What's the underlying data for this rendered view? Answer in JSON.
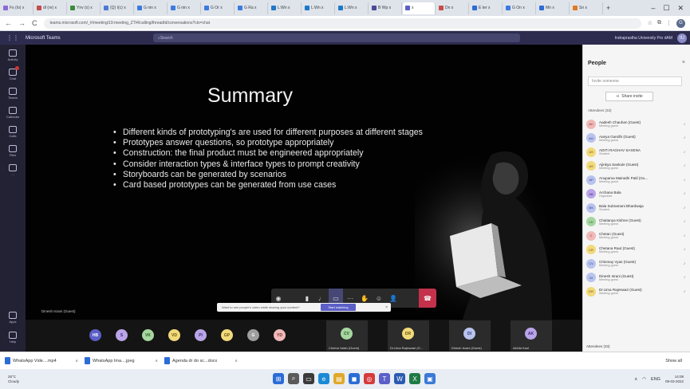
{
  "colors": {
    "teams_header": "#2d2c4f",
    "teams_accent": "#5b5fc7",
    "hangup": "#c4314b",
    "stage_bg": "#050505",
    "panel_bg": "#f5f5f5"
  },
  "browser": {
    "tabs": [
      {
        "label": "Fs (Io) x",
        "color": "#8a6ad6",
        "active": false
      },
      {
        "label": "dl (re) x",
        "color": "#c44c4c",
        "active": false
      },
      {
        "label": "Ynv (x) x",
        "color": "#3b8b3b",
        "active": false
      },
      {
        "label": "(Q) I(c) x",
        "color": "#4a7ad6",
        "active": false
      },
      {
        "label": "G nin x",
        "color": "#3b7be0",
        "active": false
      },
      {
        "label": "G nin x",
        "color": "#3b7be0",
        "active": false
      },
      {
        "label": "G Or x",
        "color": "#3b7be0",
        "active": false
      },
      {
        "label": "G Ra x",
        "color": "#3b7be0",
        "active": false
      },
      {
        "label": "L:Wn x",
        "color": "#1f78c8",
        "active": false
      },
      {
        "label": "L:Wn x",
        "color": "#1f78c8",
        "active": false
      },
      {
        "label": "L:Wn x",
        "color": "#1f78c8",
        "active": false
      },
      {
        "label": "B Wp x",
        "color": "#4a4a9a",
        "active": false
      },
      {
        "label": "x",
        "color": "#5b5fc7",
        "active": true
      },
      {
        "label": "Dn x",
        "color": "#c44c4c",
        "active": false
      },
      {
        "label": "E ter x",
        "color": "#2b6cd6",
        "active": false
      },
      {
        "label": "G On x",
        "color": "#3b7be0",
        "active": false
      },
      {
        "label": "Mn x",
        "color": "#2b6cd6",
        "active": false
      },
      {
        "label": "Sn x",
        "color": "#e07a1f",
        "active": false
      }
    ],
    "new_tab": "+",
    "window_controls": [
      "–",
      "☐",
      "✕"
    ],
    "url": "teams.microsoft.com/_#/meeting/19:meeting_ZTI4/calling/threadId/conversations?ctx=chat"
  },
  "teams": {
    "waffle_icon": "grid-icon",
    "app_name": "Microsoft Teams",
    "search_placeholder": "Search",
    "org_name": "Indraprastha University Pro dAM",
    "user_initials": "IU"
  },
  "rail": {
    "items": [
      {
        "name": "activity",
        "label": "Activity",
        "badge": false
      },
      {
        "name": "chat",
        "label": "Chat",
        "badge": true
      },
      {
        "name": "teams",
        "label": "Teams",
        "badge": false
      },
      {
        "name": "calendar",
        "label": "Calendar",
        "badge": false
      },
      {
        "name": "calls",
        "label": "Calls",
        "badge": false
      },
      {
        "name": "files",
        "label": "Files",
        "badge": false
      },
      {
        "name": "more",
        "label": "...",
        "badge": false
      }
    ],
    "bottom": [
      {
        "name": "apps",
        "label": "Apps"
      },
      {
        "name": "help",
        "label": "Help"
      }
    ]
  },
  "slide": {
    "title": "Summary",
    "bullets": [
      "Different kinds of prototyping's are used for different purposes at different stages",
      "Prototypes answer questions, so prototype appropriately",
      "Construction: the final product must be engineered appropriately",
      "Consider interaction types & interface types to prompt creativity",
      "Storyboards can be generated by scenarios",
      "Card based prototypes can be generated from use cases"
    ],
    "presenter_label": "Dinesh Israni (Guest)"
  },
  "controls": {
    "buttons": [
      {
        "name": "timer",
        "glyph": "◉"
      },
      {
        "name": "blank",
        "glyph": " "
      },
      {
        "name": "camera",
        "glyph": "▮"
      },
      {
        "name": "mic",
        "glyph": "♩"
      },
      {
        "name": "share",
        "glyph": "▭"
      },
      {
        "name": "more",
        "glyph": "···"
      },
      {
        "name": "raise-hand",
        "glyph": "✋"
      },
      {
        "name": "reactions",
        "glyph": "☺"
      },
      {
        "name": "people",
        "glyph": "👤"
      }
    ],
    "hangup_glyph": "☎"
  },
  "banner": {
    "text": "Want to see people's video while sharing your content?",
    "button": "Start watching",
    "close": "×"
  },
  "participants_strip": [
    {
      "initials": "HB",
      "bg": "#5b5fc7",
      "fg": "#fff"
    },
    {
      "initials": "S",
      "bg": "#b9a4e8",
      "fg": "#3b2a7a"
    },
    {
      "initials": "VK",
      "bg": "#a6d7a0",
      "fg": "#2c5a25"
    },
    {
      "initials": "VD",
      "bg": "#f2d97a",
      "fg": "#6b5510"
    },
    {
      "initials": "PI",
      "bg": "#b9a4e8",
      "fg": "#3b2a7a"
    },
    {
      "initials": "GP",
      "bg": "#f2d97a",
      "fg": "#6b5510"
    },
    {
      "initials": "G",
      "bg": "#9e9e9e",
      "fg": "#fff"
    },
    {
      "initials": "YD",
      "bg": "#f0b9b9",
      "fg": "#7a2a2a"
    }
  ],
  "speaker_tiles": [
    {
      "initials": "CV",
      "bg": "#a6d7a0",
      "fg": "#2c5a25",
      "name": "Chetna Vaish (Guest)"
    },
    {
      "initials": "DR",
      "bg": "#f2d97a",
      "fg": "#6b5510",
      "name": "Dr.Uma Rajeswari (G..."
    },
    {
      "initials": "DI",
      "bg": "#b9c3ee",
      "fg": "#2c3a7a",
      "name": "Dinesh Israni (Guest)"
    },
    {
      "initials": "AK",
      "bg": "#b9a4e8",
      "fg": "#3b2a7a",
      "name": "Akhila Kaul"
    }
  ],
  "people": {
    "title": "People",
    "close": "×",
    "invite_placeholder": "Invite someone",
    "share_invite": "Share invite",
    "attendees_header": "Attendees (33)",
    "list": [
      {
        "initials": "AC",
        "bg": "#f0b9b9",
        "fg": "#7a2a2a",
        "name": "Aadesh Chauhan (Guest)",
        "role": "Meeting guest"
      },
      {
        "initials": "AG",
        "bg": "#b9c3ee",
        "fg": "#2c3a7a",
        "name": "Aanya Gandhi (Guest)",
        "role": "Meeting guest"
      },
      {
        "initials": "AS",
        "bg": "#f2d97a",
        "fg": "#6b5510",
        "name": "ADITI RAGHAV SAXENA",
        "role": "Student"
      },
      {
        "initials": "AS",
        "bg": "#f2d97a",
        "fg": "#6b5510",
        "name": "Ajinkya Sankule (Guest)",
        "role": "Meeting guest"
      },
      {
        "initials": "AP",
        "bg": "#b9c3ee",
        "fg": "#2c3a7a",
        "name": "Anupama Mainathi Patil (Gu...",
        "role": "Meeting guest"
      },
      {
        "initials": "AB",
        "bg": "#b9a4e8",
        "fg": "#3b2a7a",
        "name": "Archana Bala",
        "role": "Organizer"
      },
      {
        "initials": "BS",
        "bg": "#b9c3ee",
        "fg": "#2c3a7a",
        "name": "Bala Subramani Bhardwaja",
        "role": "Student"
      },
      {
        "initials": "CK",
        "bg": "#a6d7a0",
        "fg": "#2c5a25",
        "name": "Chaitanya Kishne (Guest)",
        "role": "Meeting guest"
      },
      {
        "initials": "C",
        "bg": "#f0b9b9",
        "fg": "#7a2a2a",
        "name": "Chetan (Guest)",
        "role": "Meeting guest"
      },
      {
        "initials": "CR",
        "bg": "#f2d97a",
        "fg": "#6b5510",
        "name": "Chetana Raut (Guest)",
        "role": "Meeting guest"
      },
      {
        "initials": "CV",
        "bg": "#b9c3ee",
        "fg": "#2c3a7a",
        "name": "Chinmay Vyas (Guest)",
        "role": "Meeting guest"
      },
      {
        "initials": "DI",
        "bg": "#b9c3ee",
        "fg": "#2c3a7a",
        "name": "Dinesh Israni (Guest)",
        "role": "Meeting guest"
      },
      {
        "initials": "DR",
        "bg": "#f2d97a",
        "fg": "#6b5510",
        "name": "Dr.Uma Rajeswari (Guest)",
        "role": "Meeting guest"
      }
    ],
    "attendees_footer": "Attendees (33)"
  },
  "downloads": [
    {
      "name": "WhatsApp Vide....mp4"
    },
    {
      "name": "WhatsApp Ima....jpeg"
    },
    {
      "name": "Agenda dr do sc...docx"
    }
  ],
  "downloads_show_all": "Show all",
  "taskbar": {
    "weather_temp": "26°C",
    "weather_desc": "Cloudy",
    "apps": [
      {
        "name": "start",
        "glyph": "⊞",
        "bg": "#2b6cd6"
      },
      {
        "name": "search",
        "glyph": "⌕",
        "bg": "#5a5a5a"
      },
      {
        "name": "task-view",
        "glyph": "▭",
        "bg": "#3a3a3a"
      },
      {
        "name": "edge",
        "glyph": "e",
        "bg": "#1a8ad6"
      },
      {
        "name": "files",
        "glyph": "▤",
        "bg": "#e0a82b"
      },
      {
        "name": "store",
        "glyph": "◼",
        "bg": "#2b6cd6"
      },
      {
        "name": "chrome",
        "glyph": "◎",
        "bg": "#d63b3b"
      },
      {
        "name": "teams",
        "glyph": "T",
        "bg": "#5b5fc7"
      },
      {
        "name": "word",
        "glyph": "W",
        "bg": "#2b5bb0"
      },
      {
        "name": "excel",
        "glyph": "X",
        "bg": "#1f7a44"
      },
      {
        "name": "app",
        "glyph": "▣",
        "bg": "#3a7ad6"
      }
    ],
    "tray": "ENG",
    "time": "14:08",
    "date": "09-03-2022"
  }
}
